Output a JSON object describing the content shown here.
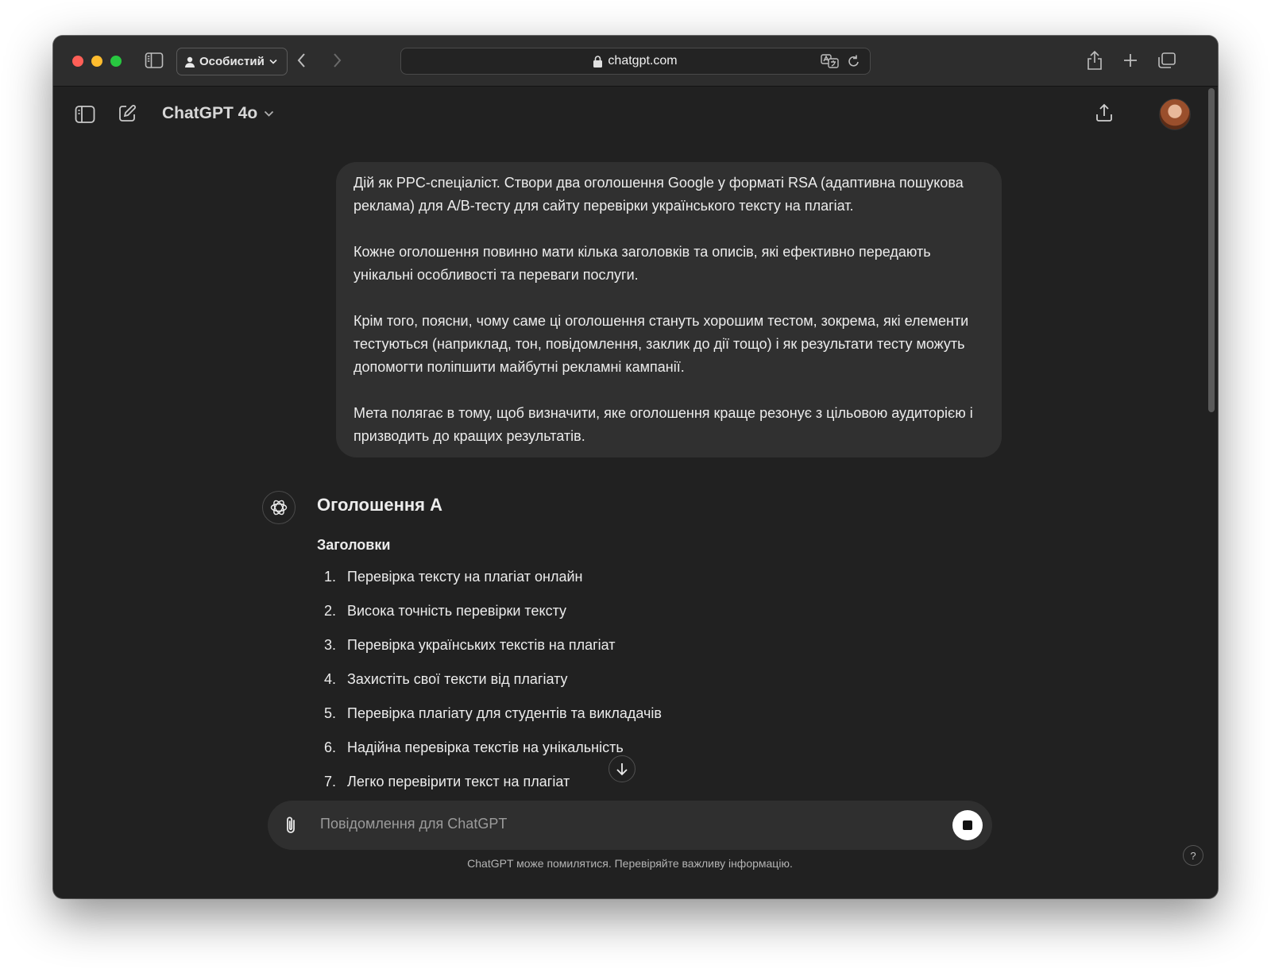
{
  "browser": {
    "profile_label": "Особистий",
    "url": "chatgpt.com"
  },
  "app": {
    "model_name": "ChatGPT 4o"
  },
  "user_message": {
    "paragraphs": [
      "Дій як PPC-спеціаліст. Створи два оголошення Google у форматі RSA (адаптивна пошукова реклама) для A/B-тесту для сайту перевірки українського тексту на плагіат.",
      "Кожне оголошення повинно мати кілька заголовків та описів, які ефективно передають унікальні особливості та переваги послуги.",
      "Крім того, поясни, чому саме ці оголошення стануть хорошим тестом, зокрема, які елементи тестуються (наприклад, тон, повідомлення, заклик до дії тощо) і як результати тесту можуть допомогти поліпшити майбутні рекламні кампанії.",
      "Мета полягає в тому, щоб визначити, яке оголошення краще резонує з цільовою аудиторією і призводить до кращих результатів."
    ]
  },
  "assistant": {
    "heading": "Оголошення A",
    "subheading": "Заголовки",
    "items": [
      {
        "num": "1.",
        "text": "Перевірка тексту на плагіат онлайн"
      },
      {
        "num": "2.",
        "text": "Висока точність перевірки тексту"
      },
      {
        "num": "3.",
        "text": "Перевірка українських текстів на плагіат"
      },
      {
        "num": "4.",
        "text": "Захистіть свої тексти від плагіату"
      },
      {
        "num": "5.",
        "text": "Перевірка плагіату для студентів та викладачів"
      },
      {
        "num": "6.",
        "text": "Надійна перевірка текстів на унікальність"
      },
      {
        "num": "7.",
        "text": "Легко перевірити текст на плагіат"
      }
    ]
  },
  "composer": {
    "placeholder": "Повідомлення для ChatGPT"
  },
  "footer": {
    "disclaimer": "ChatGPT може помилятися. Перевіряйте важливу інформацію.",
    "help": "?"
  },
  "colors": {
    "background": "#212121",
    "bubble": "#303030",
    "text": "#ececec",
    "toolbar": "#2d2d2d"
  },
  "icons": [
    "sidebar-icon",
    "person-icon",
    "chevron-down-icon",
    "back-icon",
    "forward-icon",
    "lock-icon",
    "translate-icon",
    "reload-icon",
    "share-icon",
    "new-tab-icon",
    "tabs-overview-icon",
    "toggle-sidebar-icon",
    "new-chat-icon",
    "upload-icon",
    "openai-logo-icon",
    "arrow-down-icon",
    "paperclip-icon",
    "stop-icon"
  ]
}
